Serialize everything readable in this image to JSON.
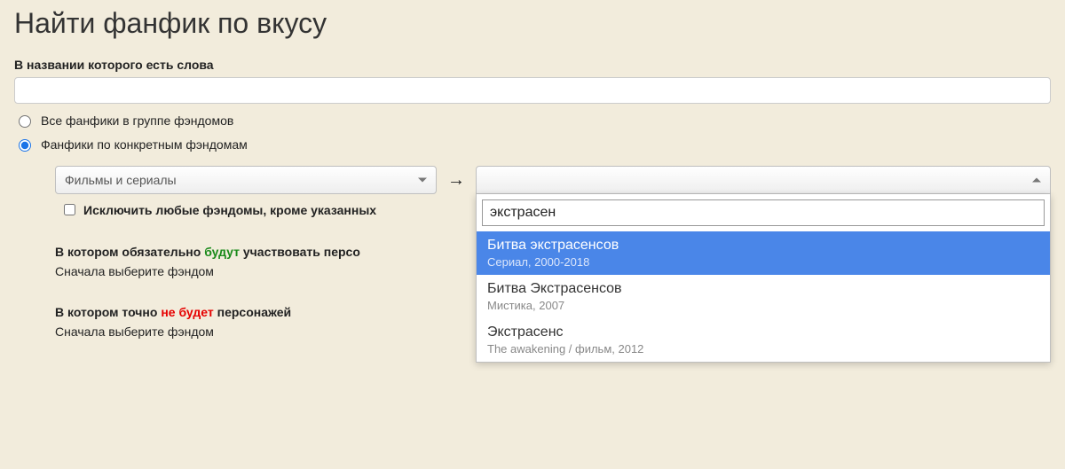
{
  "title": "Найти фанфик по вкусу",
  "titleContainsLabel": "В названии которого есть слова",
  "titleValue": "",
  "radios": {
    "all": "Все фанфики в группе фэндомов",
    "specific": "Фанфики по конкретным фэндомам"
  },
  "categorySelect": "Фильмы и сериалы",
  "arrow": "→",
  "searchValue": "экстрасен",
  "excludeLabel": "Исключить любые фэндомы, кроме указанных",
  "suggestions": [
    {
      "title": "Битва экстрасенсов",
      "sub": "Сериал, 2000-2018"
    },
    {
      "title": "Битва Экстрасенсов",
      "sub": "Мистика, 2007"
    },
    {
      "title": "Экстрасенс",
      "sub": "The awakening / фильм, 2012"
    }
  ],
  "mustSection": {
    "pre": "В котором обязательно ",
    "em": "будут",
    "post": " участвовать персо",
    "hint": "Сначала выберите фэндом"
  },
  "notSection": {
    "pre": "В котором точно ",
    "em": "не будет",
    "post": " персонажей",
    "hint": "Сначала выберите фэндом"
  }
}
